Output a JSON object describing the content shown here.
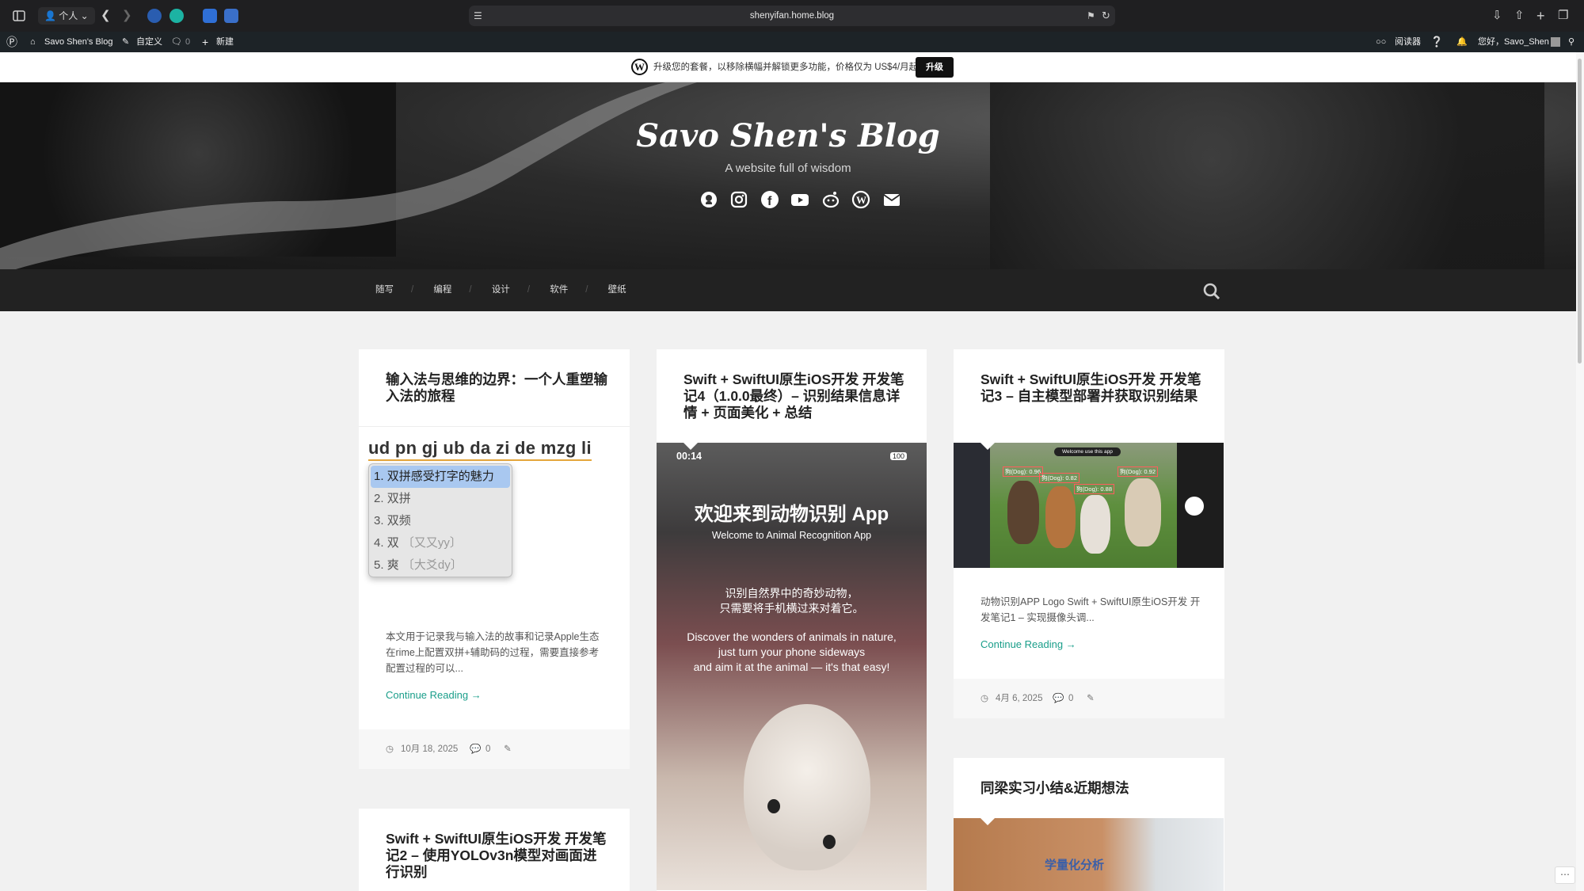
{
  "browser": {
    "profile": "个人",
    "url": "shenyifan.home.blog"
  },
  "adminbar": {
    "site_name": "Savo Shen's Blog",
    "customize": "自定义",
    "comments_count": "0",
    "new": "新建",
    "reader": "阅读器",
    "greeting": "您好，Savo_Shen"
  },
  "promo": {
    "text": "升级您的套餐，以移除横幅并解锁更多功能，价格仅为 US$4/月起",
    "button": "升级"
  },
  "site": {
    "title": "Savo Shen's Blog",
    "description": "A website full of wisdom"
  },
  "social_icons": [
    "github-icon",
    "instagram-icon",
    "facebook-icon",
    "youtube-icon",
    "reddit-icon",
    "wordpress-icon",
    "mail-icon"
  ],
  "nav": {
    "items": [
      "随写",
      "编程",
      "设计",
      "软件",
      "壁纸"
    ]
  },
  "posts": [
    {
      "title": "输入法与思维的边界：一个人重塑输入法的旅程",
      "ime": {
        "input": "ud pn gj ub da zi de mzg li",
        "candidates": [
          {
            "n": "1.",
            "text": "双拼感受打字的魅力",
            "hint": ""
          },
          {
            "n": "2.",
            "text": "双拼",
            "hint": ""
          },
          {
            "n": "3.",
            "text": "双频",
            "hint": ""
          },
          {
            "n": "4.",
            "text": "双",
            "hint": "〔又又yy〕"
          },
          {
            "n": "5.",
            "text": "爽",
            "hint": "〔大爻dy〕"
          }
        ]
      },
      "excerpt": "本文用于记录我与输入法的故事和记录Apple生态在rime上配置双拼+辅助码的过程，需要直接参考配置过程的可以...",
      "more": "Continue Reading →",
      "date": "10月 18, 2025",
      "comments": "0"
    },
    {
      "title": "Swift + SwiftUI原生iOS开发 开发笔记4（1.0.0最终）– 识别结果信息详情 + 页面美化 + 总结",
      "phone": {
        "time": "00:14",
        "battery": "100",
        "heading": "欢迎来到动物识别 App",
        "subheading": "Welcome to Animal Recognition App",
        "cn_line1": "识别自然界中的奇妙动物，",
        "cn_line2": "只需要将手机横过来对着它。",
        "en_line1": "Discover the wonders of animals in nature,",
        "en_line2": "just turn your phone sideways",
        "en_line3": "and aim it at the animal — it's that easy!"
      }
    },
    {
      "title": "Swift + SwiftUI原生iOS开发 开发笔记3 – 自主模型部署并获取识别结果",
      "image": {
        "banner": "Welcome use this app",
        "labels": [
          "狗(Dog): 0.96",
          "狗(Dog): 0.82",
          "狗(Dog): 0.88",
          "狗(Dog): 0.92"
        ]
      },
      "excerpt": "动物识别APP Logo Swift + SwiftUI原生iOS开发 开发笔记1 – 实现摄像头调...",
      "more": "Continue Reading →",
      "date": "4月 6, 2025",
      "comments": "0"
    },
    {
      "title": "同梁实习小结&近期想法",
      "image_text": "学量化分析"
    },
    {
      "title": "Swift + SwiftUI原生iOS开发 开发笔记2 – 使用YOLOv3n模型对画面进行识别"
    }
  ]
}
